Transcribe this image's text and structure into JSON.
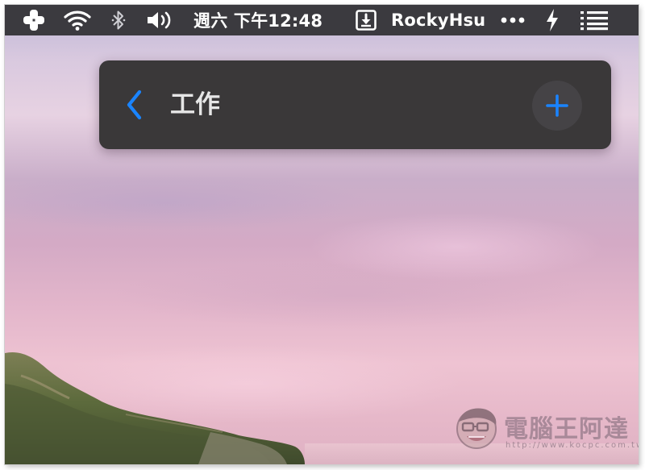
{
  "menubar": {
    "items": [
      {
        "icon": "plus-cross-icon"
      },
      {
        "icon": "wifi-icon"
      },
      {
        "icon": "bluetooth-icon"
      },
      {
        "icon": "volume-icon"
      }
    ],
    "datetime": "週六 下午12:48",
    "download_icon": "download-icon",
    "username": "RockyHsu",
    "more_icon": "ellipsis-icon",
    "bolt_icon": "lightning-icon",
    "list_icon": "list-icon"
  },
  "panel": {
    "back_icon": "chevron-left-icon",
    "title": "工作",
    "add_icon": "plus-icon",
    "accent_color": "#1a84ff"
  },
  "watermark": {
    "title": "電腦王阿達",
    "url": "http://www.kocpc.com.tw"
  }
}
